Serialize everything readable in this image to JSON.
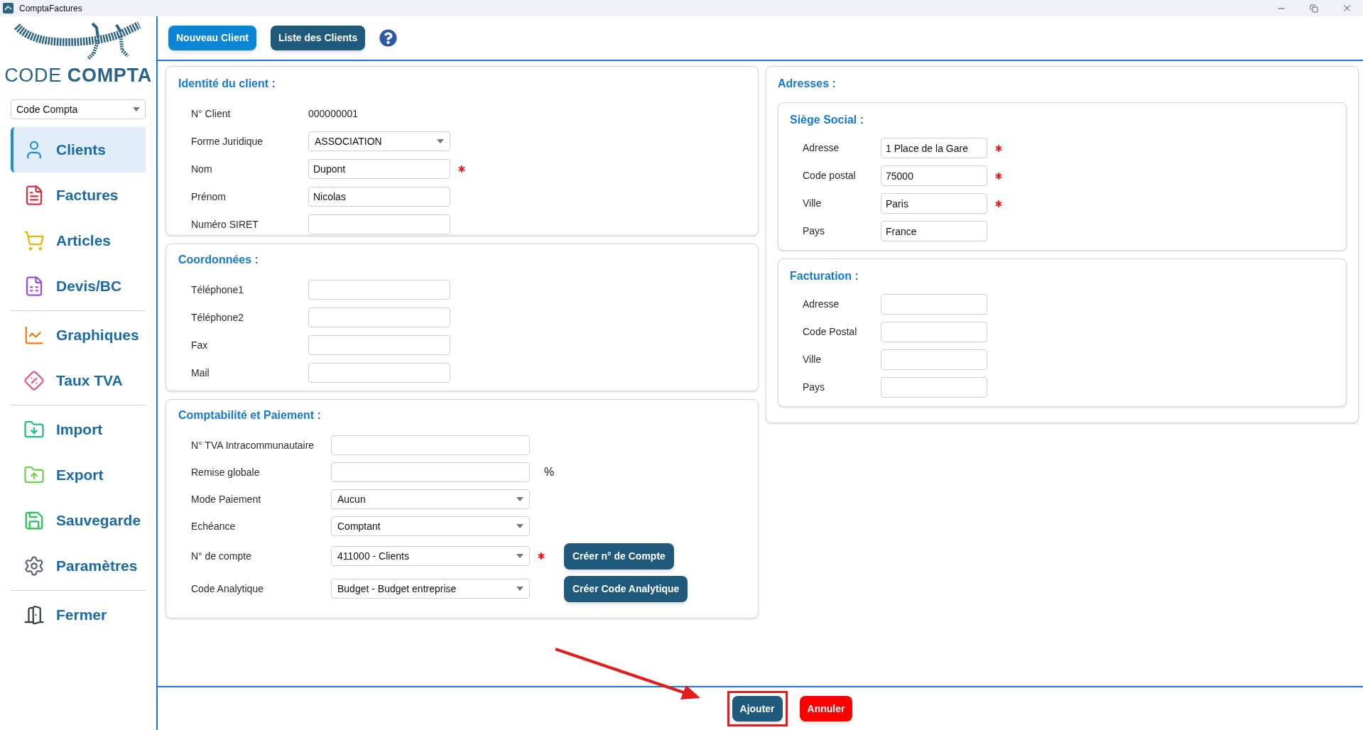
{
  "window": {
    "title": "ComptaFactures"
  },
  "logo": {
    "word_light": "CODE",
    "word_bold": "COMPTA"
  },
  "company_select": {
    "value": "Code Compta"
  },
  "nav": [
    {
      "label": "Clients",
      "selected": true
    },
    {
      "label": "Factures",
      "selected": false
    },
    {
      "label": "Articles",
      "selected": false
    },
    {
      "label": "Devis/BC",
      "selected": false
    },
    {
      "label": "Graphiques",
      "selected": false
    },
    {
      "label": "Taux TVA",
      "selected": false
    },
    {
      "label": "Import",
      "selected": false
    },
    {
      "label": "Export",
      "selected": false
    },
    {
      "label": "Sauvegarde",
      "selected": false
    },
    {
      "label": "Paramètres",
      "selected": false
    },
    {
      "label": "Fermer",
      "selected": false
    }
  ],
  "toolbar": [
    {
      "label": "Nouveau Client",
      "kind": "primary"
    },
    {
      "label": "Liste des Clients",
      "kind": "secondary"
    }
  ],
  "identity": {
    "title": "Identité du client :",
    "fields": [
      {
        "kind": "static",
        "label": "N° Client",
        "value": "000000001",
        "required": false
      },
      {
        "kind": "select",
        "label": "Forme Juridique",
        "value": "ASSOCIATION",
        "required": false
      },
      {
        "kind": "text",
        "label": "Nom",
        "value": "Dupont",
        "required": true
      },
      {
        "kind": "text",
        "label": "Prénom",
        "value": "Nicolas",
        "required": false
      },
      {
        "kind": "text",
        "label": "Numéro SIRET",
        "required": false
      }
    ]
  },
  "contact": {
    "title": "Coordonnées :",
    "fields": [
      {
        "kind": "text",
        "label": "Téléphone1",
        "required": false
      },
      {
        "kind": "text",
        "label": "Téléphone2",
        "required": false
      },
      {
        "kind": "text",
        "label": "Fax",
        "required": false
      },
      {
        "kind": "text",
        "label": "Mail",
        "required": false
      }
    ]
  },
  "accounting": {
    "title": "Comptabilité et Paiement :",
    "fields": [
      {
        "kind": "text",
        "label": "N° TVA Intracommunautaire",
        "required": false
      },
      {
        "kind": "text",
        "label": "Remise globale",
        "required": false,
        "suffix": "%"
      },
      {
        "kind": "select",
        "label": "Mode Paiement",
        "value": "Aucun",
        "required": false
      },
      {
        "kind": "select",
        "label": "Echéance",
        "value": "Comptant",
        "required": false
      },
      {
        "kind": "select",
        "label": "N° de compte",
        "value": "411000 - Clients",
        "required": true,
        "button": "Créer n° de Compte"
      },
      {
        "kind": "select",
        "label": "Code Analytique",
        "value": "Budget - Budget entreprise",
        "required": false,
        "button": "Créer Code Analytique"
      }
    ]
  },
  "addresses": {
    "title": "Adresses :",
    "groups": [
      {
        "title": "Siège Social :",
        "fields": [
          {
            "kind": "text",
            "label": "Adresse",
            "value": "1 Place de la Gare",
            "required": true
          },
          {
            "kind": "text",
            "label": "Code postal",
            "value": "75000",
            "required": true
          },
          {
            "kind": "text",
            "label": "Ville",
            "value": "Paris",
            "required": true
          },
          {
            "kind": "text",
            "label": "Pays",
            "value": "France",
            "required": false
          }
        ]
      },
      {
        "title": "Facturation :",
        "fields": [
          {
            "kind": "text",
            "label": "Adresse",
            "required": false
          },
          {
            "kind": "text",
            "label": "Code Postal",
            "required": false
          },
          {
            "kind": "text",
            "label": "Ville",
            "required": false
          },
          {
            "kind": "text",
            "label": "Pays",
            "required": false
          }
        ]
      }
    ]
  },
  "actions": [
    {
      "label": "Ajouter",
      "kind": "primary",
      "highlighted": true
    },
    {
      "label": "Annuler",
      "kind": "danger",
      "highlighted": false
    }
  ]
}
